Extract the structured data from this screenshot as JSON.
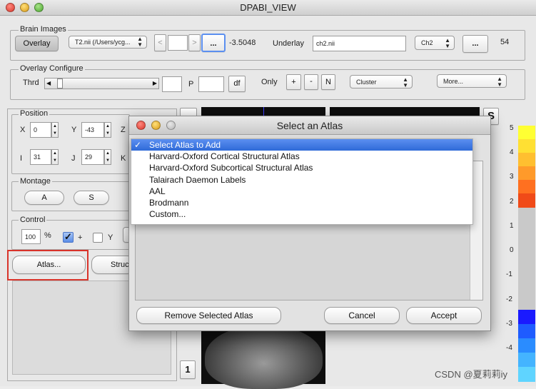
{
  "window": {
    "title": "DPABI_VIEW"
  },
  "brain_images": {
    "group_label": "Brain Images",
    "overlay_button": "Overlay",
    "overlay_file": "T2.nii (/Users/ycg...",
    "nav_prev": "<",
    "nav_next": ">",
    "ellipsis1": "...",
    "value": "-3.5048",
    "underlay_label": "Underlay",
    "underlay_file": "ch2.nii",
    "ch2_select": "Ch2",
    "ellipsis2": "...",
    "count": "54"
  },
  "overlay_configure": {
    "group_label": "Overlay Configure",
    "thrd_label": "Thrd",
    "p_label": "P",
    "df_button": "df",
    "only_label": "Only",
    "plus_button": "+",
    "minus_button": "-",
    "n_button": "N",
    "cluster_select": "Cluster",
    "more_select": "More..."
  },
  "position": {
    "group_label": "Position",
    "x_label": "X",
    "x_value": "0",
    "y_label": "Y",
    "y_value": "-43",
    "z_label": "Z",
    "i_label": "I",
    "i_value": "31",
    "j_label": "J",
    "j_value": "29",
    "k_label": "K"
  },
  "montage": {
    "group_label": "Montage",
    "a_button": "A",
    "s_button": "S"
  },
  "control": {
    "group_label": "Control",
    "percent_value": "100",
    "percent_label": "%",
    "plus_check_label": "+",
    "y_check_label": "Y",
    "atlas_button": "Atlas...",
    "struct_button": "Struc"
  },
  "views": {
    "s_label": "S",
    "slice_number": "1"
  },
  "colorbar": {
    "ticks": [
      "5",
      "4",
      "3",
      "2",
      "1",
      "0",
      "-1",
      "-2",
      "-3",
      "-4"
    ],
    "colors_top": [
      "#ffff33",
      "#ffe033",
      "#ffbf30",
      "#ff9a2a",
      "#ff7020",
      "#f04a18"
    ],
    "colors_bottom": [
      "#1a1aff",
      "#1f5cff",
      "#2a8cff",
      "#44b4ff",
      "#5fd4ff"
    ]
  },
  "dialog": {
    "title": "Select an Atlas",
    "menu_items": [
      "Select Atlas to Add",
      "Harvard-Oxford Cortical Structural Atlas",
      "Harvard-Oxford Subcortical Structural Atlas",
      "Talairach Daemon Labels",
      "AAL",
      "Brodmann",
      "Custom..."
    ],
    "checkmark": "✓",
    "remove_button": "Remove Selected Atlas",
    "cancel_button": "Cancel",
    "accept_button": "Accept"
  },
  "watermark": "CSDN @夏莉莉iy",
  "highlight_color": "#d9342b"
}
